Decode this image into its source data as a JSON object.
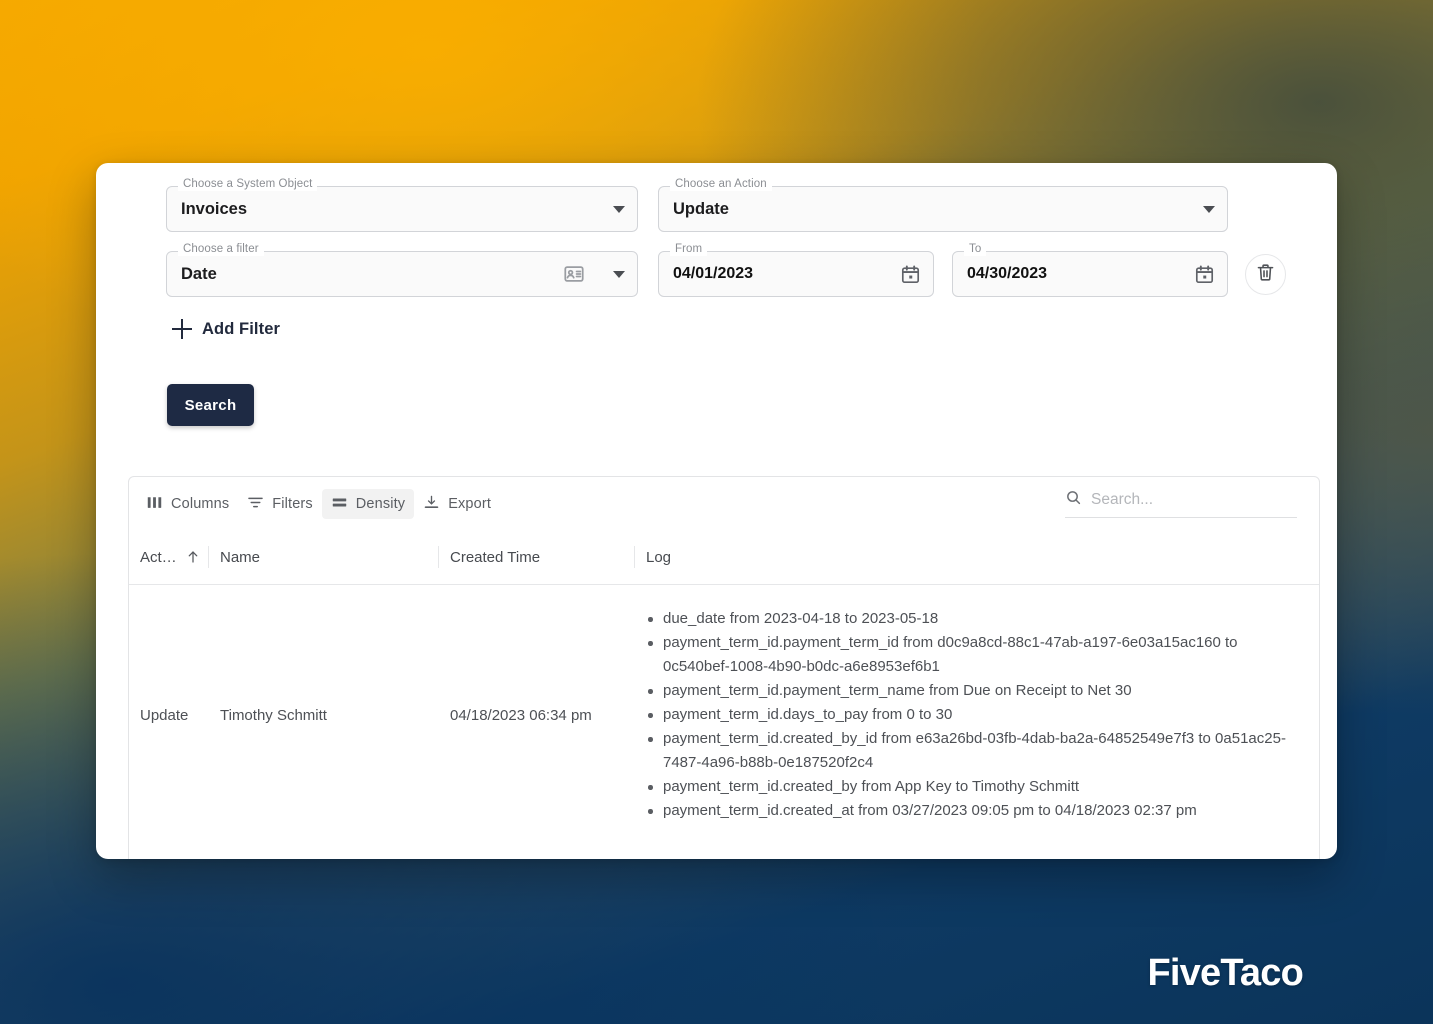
{
  "background": {
    "gradient_top": "#f5a800",
    "gradient_mid": "#4e5646",
    "gradient_bottom": "#0b345a"
  },
  "brand": {
    "name": "FiveTaco"
  },
  "filters": {
    "system_object": {
      "legend": "Choose a System Object",
      "value": "Invoices",
      "icon": "chevron-down-icon"
    },
    "action": {
      "legend": "Choose an Action",
      "value": "Update",
      "icon": "chevron-down-icon"
    },
    "filter": {
      "legend": "Choose a filter",
      "value": "Date",
      "icon": "badge-icon",
      "icon2": "chevron-down-icon"
    },
    "from": {
      "legend": "From",
      "value": "04/01/2023",
      "icon": "calendar-icon"
    },
    "to": {
      "legend": "To",
      "value": "04/30/2023",
      "icon": "calendar-icon"
    },
    "delete_icon": "trash-icon",
    "add_filter_label": "Add Filter",
    "add_filter_icon": "plus-icon",
    "search_button_label": "Search",
    "search_button_color": "#1e2a44"
  },
  "grid": {
    "toolbar": [
      {
        "label": "Columns",
        "icon": "columns-icon",
        "active": false
      },
      {
        "label": "Filters",
        "icon": "filter-icon",
        "active": false
      },
      {
        "label": "Density",
        "icon": "density-icon",
        "active": true
      },
      {
        "label": "Export",
        "icon": "download-icon",
        "active": false
      }
    ],
    "search": {
      "placeholder": "Search...",
      "value": "",
      "icon": "search-icon"
    },
    "columns": [
      {
        "label": "Act…",
        "sorted": "asc",
        "sort_icon": "arrow-up-icon"
      },
      {
        "label": "Name",
        "sorted": "",
        "sort_icon": ""
      },
      {
        "label": "Created Time",
        "sorted": "",
        "sort_icon": ""
      },
      {
        "label": "Log",
        "sorted": "",
        "sort_icon": ""
      }
    ],
    "rows": [
      {
        "action": "Update",
        "name": "Timothy Schmitt",
        "created_time": "04/18/2023 06:34 pm",
        "log": [
          "due_date from 2023-04-18 to 2023-05-18",
          "payment_term_id.payment_term_id from d0c9a8cd-88c1-47ab-a197-6e03a15ac160 to 0c540bef-1008-4b90-b0dc-a6e8953ef6b1",
          "payment_term_id.payment_term_name from Due on Receipt to Net 30",
          "payment_term_id.days_to_pay from 0 to 30",
          "payment_term_id.created_by_id from e63a26bd-03fb-4dab-ba2a-64852549e7f3 to 0a51ac25-7487-4a96-b88b-0e187520f2c4",
          "payment_term_id.created_by from App Key to Timothy Schmitt",
          "payment_term_id.created_at from 03/27/2023 09:05 pm to 04/18/2023 02:37 pm"
        ]
      }
    ]
  }
}
